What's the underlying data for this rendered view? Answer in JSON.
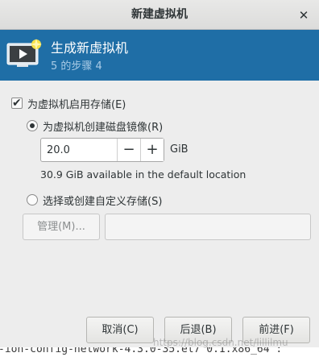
{
  "window": {
    "title": "新建虚拟机",
    "close_glyph": "✕"
  },
  "header": {
    "title": "生成新虚拟机",
    "step": "5 的步骤 4",
    "icon": "monitor-play-icon"
  },
  "storage": {
    "enable_label": "为虚拟机启用存储(E)",
    "enable_checked": true,
    "create_image_label": "为虚拟机创建磁盘镜像(R)",
    "create_image_selected": true,
    "size_value": "20.0",
    "decrement_glyph": "−",
    "increment_glyph": "+",
    "unit": "GiB",
    "available_text": "30.9 GiB available in the default location",
    "custom_label": "选择或创建自定义存储(S)",
    "custom_selected": false,
    "manage_label": "管理(M)...",
    "custom_path_value": ""
  },
  "buttons": {
    "cancel": "取消(C)",
    "back": "后退(B)",
    "forward": "前进(F)"
  },
  "background": {
    "terminal_text": "-ion-config-network-4.3.0-35.el7 0.1.x86_64 :",
    "watermark": "https://blog.csdn.net/lillilmu"
  },
  "colors": {
    "header_bg": "#1f6ea6",
    "header_step": "#a9cbe6",
    "window_bg": "#ededed"
  }
}
